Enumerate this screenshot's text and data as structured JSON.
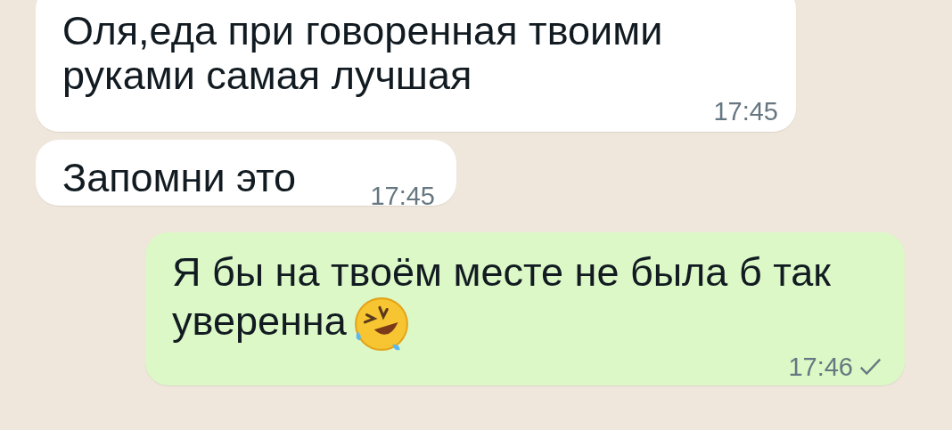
{
  "messages": [
    {
      "kind": "incoming",
      "text": "Оля,еда при говоренная твоими руками самая лучшая",
      "time": "17:45"
    },
    {
      "kind": "incoming",
      "text": "Запомни это",
      "time": "17:45"
    },
    {
      "kind": "outgoing",
      "text": "Я бы на твоём месте не была б так уверенна",
      "emoji": true,
      "time": "17:46",
      "delivered": false
    }
  ]
}
